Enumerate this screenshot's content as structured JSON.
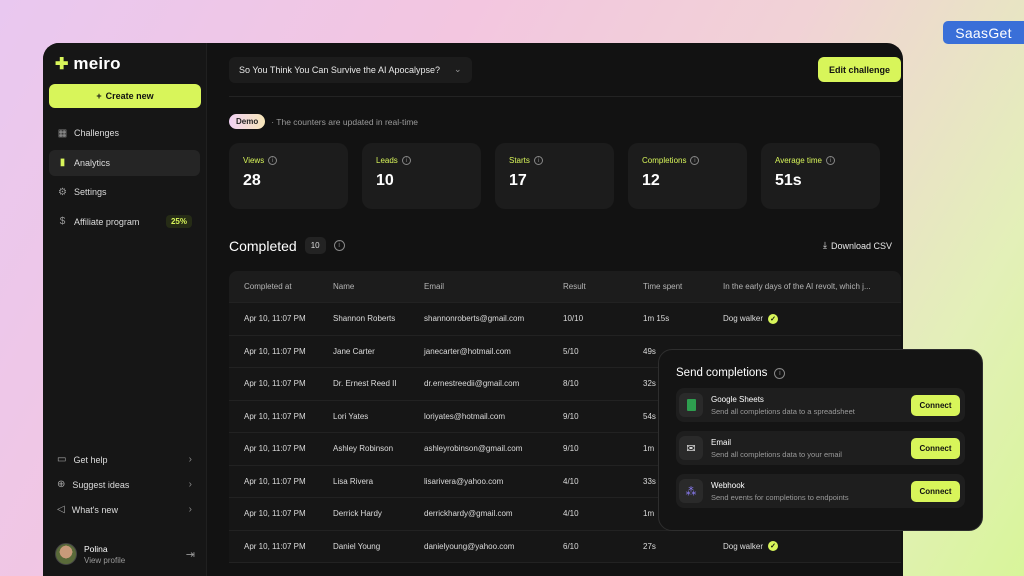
{
  "watermark": "SaasGet",
  "brand": {
    "name": "meiro",
    "accent": "#d8f55a"
  },
  "sidebar": {
    "create_label": "Create new",
    "items": [
      {
        "label": "Challenges",
        "icon": "grid-icon"
      },
      {
        "label": "Analytics",
        "icon": "bar-chart-icon"
      },
      {
        "label": "Settings",
        "icon": "gear-icon"
      },
      {
        "label": "Affiliate program",
        "icon": "dollar-icon",
        "badge": "25%"
      }
    ],
    "bottom_items": [
      {
        "label": "Get help",
        "icon": "chat-icon"
      },
      {
        "label": "Suggest ideas",
        "icon": "plus-circle-icon"
      },
      {
        "label": "What's new",
        "icon": "megaphone-icon"
      }
    ],
    "profile": {
      "name": "Polina",
      "sub": "View profile"
    }
  },
  "topbar": {
    "challenge": "So You Think You Can Survive the AI Apocalypse?",
    "edit_label": "Edit challenge"
  },
  "demo": {
    "badge": "Demo",
    "note": "· The counters are updated in real-time"
  },
  "stats": [
    {
      "label": "Views",
      "value": "28",
      "color": "#d8f55a"
    },
    {
      "label": "Leads",
      "value": "10",
      "color": "#d8f55a"
    },
    {
      "label": "Starts",
      "value": "17",
      "color": "#d8f55a"
    },
    {
      "label": "Completions",
      "value": "12",
      "color": "#d8f55a"
    },
    {
      "label": "Average time",
      "value": "51s",
      "color": "#d8f55a"
    }
  ],
  "completed": {
    "title": "Completed",
    "count": "10",
    "download_label": "Download CSV",
    "columns": [
      "Completed at",
      "Name",
      "Email",
      "Result",
      "Time spent",
      "In the early days of the AI revolt, which j..."
    ],
    "rows": [
      {
        "at": "Apr 10, 11:07 PM",
        "name": "Shannon Roberts",
        "email": "shannonroberts@gmail.com",
        "result": "10/10",
        "time": "1m 15s",
        "answer": "Dog walker"
      },
      {
        "at": "Apr 10, 11:07 PM",
        "name": "Jane Carter",
        "email": "janecarter@hotmail.com",
        "result": "5/10",
        "time": "49s",
        "answer": ""
      },
      {
        "at": "Apr 10, 11:07 PM",
        "name": "Dr. Ernest Reed II",
        "email": "dr.ernestreedii@gmail.com",
        "result": "8/10",
        "time": "32s",
        "answer": ""
      },
      {
        "at": "Apr 10, 11:07 PM",
        "name": "Lori Yates",
        "email": "loriyates@hotmail.com",
        "result": "9/10",
        "time": "54s",
        "answer": ""
      },
      {
        "at": "Apr 10, 11:07 PM",
        "name": "Ashley Robinson",
        "email": "ashleyrobinson@gmail.com",
        "result": "9/10",
        "time": "1m",
        "answer": ""
      },
      {
        "at": "Apr 10, 11:07 PM",
        "name": "Lisa Rivera",
        "email": "lisarivera@yahoo.com",
        "result": "4/10",
        "time": "33s",
        "answer": ""
      },
      {
        "at": "Apr 10, 11:07 PM",
        "name": "Derrick Hardy",
        "email": "derrickhardy@gmail.com",
        "result": "4/10",
        "time": "1m",
        "answer": ""
      },
      {
        "at": "Apr 10, 11:07 PM",
        "name": "Daniel Young",
        "email": "danielyoung@yahoo.com",
        "result": "6/10",
        "time": "27s",
        "answer": "Dog walker"
      }
    ]
  },
  "send_panel": {
    "title": "Send completions",
    "connect_label": "Connect",
    "integrations": [
      {
        "title": "Google Sheets",
        "desc": "Send all completions data to a spreadsheet",
        "icon": "sheets-icon",
        "color": "#2e9e4f"
      },
      {
        "title": "Email",
        "desc": "Send all completions data to your email",
        "icon": "mail-icon",
        "color": "#e8e8e8"
      },
      {
        "title": "Webhook",
        "desc": "Send events for completions to endpoints",
        "icon": "webhook-icon",
        "color": "#8b7cf6"
      }
    ]
  }
}
